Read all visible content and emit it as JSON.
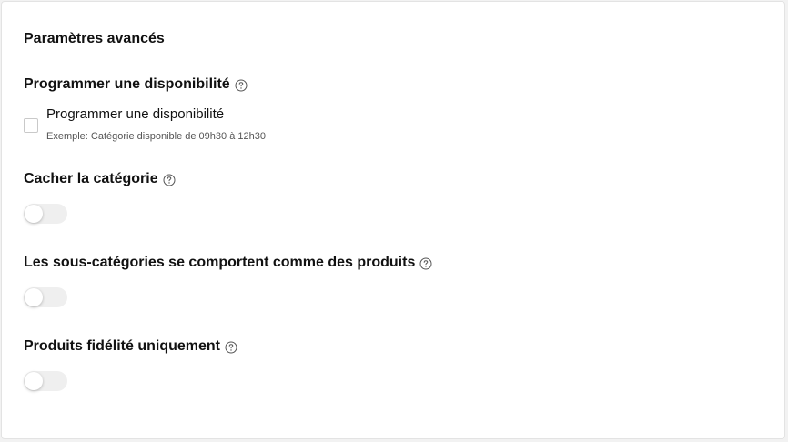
{
  "panel": {
    "title": "Paramètres avancés"
  },
  "availability": {
    "heading": "Programmer une disponibilité",
    "checkbox_label": "Programmer une disponibilité",
    "checkbox_hint": "Exemple: Catégorie disponible de 09h30 à 12h30",
    "checked": false
  },
  "hide_category": {
    "heading": "Cacher la catégorie",
    "enabled": false
  },
  "subcategories_as_products": {
    "heading": "Les sous-catégories se comportent comme des produits",
    "enabled": false
  },
  "loyalty_only": {
    "heading": "Produits fidélité uniquement",
    "enabled": false
  },
  "icons": {
    "help": "help-circle-icon"
  },
  "colors": {
    "toggle_off_track": "#efefef",
    "text": "#111111",
    "hint_text": "#555555"
  }
}
